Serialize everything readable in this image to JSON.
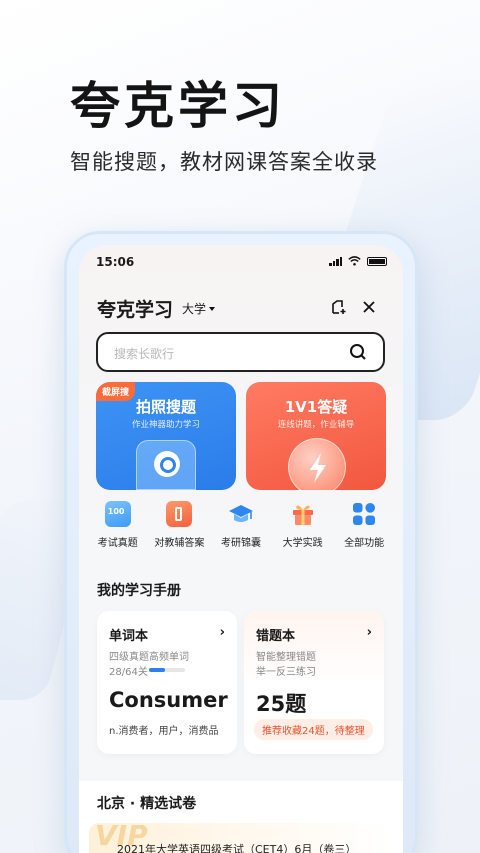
{
  "hero": {
    "title": "夸克学习",
    "subtitle": "智能搜题，教材网课答案全收录"
  },
  "status_bar": {
    "time": "15:06"
  },
  "header": {
    "app_title": "夸克学习",
    "level": "大学",
    "add_icon": "add-page-icon",
    "close_icon": "close-icon"
  },
  "search": {
    "placeholder": "搜索长歌行"
  },
  "cards": {
    "photo": {
      "tag": "截屏搜",
      "title": "拍照搜题",
      "subtitle": "作业神器助力学习",
      "color": "#2f86ef"
    },
    "qa": {
      "title": "1V1答疑",
      "subtitle": "连线讲题，作业辅导",
      "color": "#f4604a"
    }
  },
  "features": [
    {
      "label": "考试真题",
      "icon": "exam-icon",
      "badge": "100"
    },
    {
      "label": "对教辅答案",
      "icon": "book-icon"
    },
    {
      "label": "考研锦囊",
      "icon": "graduation-cap-icon"
    },
    {
      "label": "大学实践",
      "icon": "gift-icon"
    },
    {
      "label": "全部功能",
      "icon": "grid-icon"
    }
  ],
  "handbook": {
    "title": "我的学习手册",
    "vocab": {
      "title": "单词本",
      "desc": "四级真题高频单词",
      "progress_text": "28/64关",
      "progress": 0.4375,
      "word": "Consumer",
      "meaning": "n.消费者，用户，消费品"
    },
    "mistakes": {
      "title": "错题本",
      "desc1": "智能整理错题",
      "desc2": "举一反三练习",
      "count": "25题",
      "pill": "推荐收藏24题，待整理"
    }
  },
  "papers": {
    "title": "北京 · 精选试卷",
    "badge": "VIP",
    "first": "2021年大学英语四级考试（CET4）6月（卷三）"
  }
}
